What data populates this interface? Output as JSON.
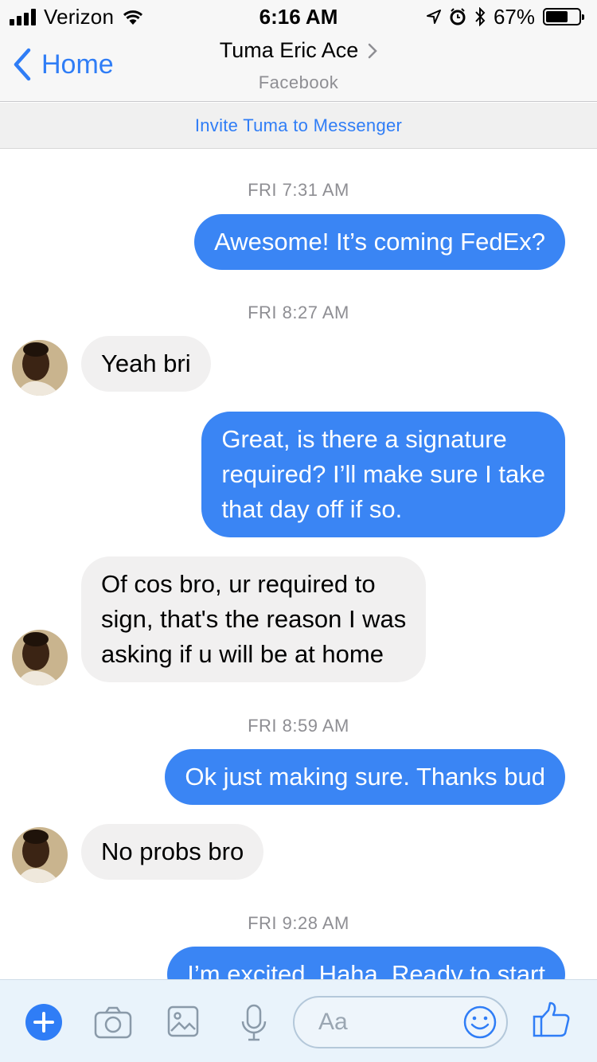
{
  "status_bar": {
    "carrier": "Verizon",
    "time": "6:16 AM",
    "battery_percent": "67%",
    "battery_level": 0.67,
    "icons": [
      "signal-icon",
      "wifi-icon",
      "location-icon",
      "alarm-icon",
      "bluetooth-icon",
      "battery-icon"
    ]
  },
  "nav": {
    "back_label": "Home",
    "title": "Tuma Eric Ace",
    "subtitle": "Facebook"
  },
  "invite_banner": "Invite Tuma to Messenger",
  "conversation": {
    "stamps": [
      "FRI 7:31 AM",
      "FRI 8:27 AM",
      "FRI 8:59 AM",
      "FRI 9:28 AM"
    ],
    "messages": [
      {
        "from": "me",
        "lines": [
          "Awesome! It’s coming FedEx?"
        ]
      },
      {
        "from": "them",
        "lines": [
          "Yeah bri"
        ]
      },
      {
        "from": "me",
        "lines": [
          "Great, is there a signature",
          "required? I’ll make sure I take",
          "that day off if so."
        ]
      },
      {
        "from": "them",
        "lines": [
          "Of cos bro, ur required to",
          "sign, that's the reason I was",
          "asking if u will be at home"
        ]
      },
      {
        "from": "me",
        "lines": [
          "Ok just making sure. Thanks bud"
        ]
      },
      {
        "from": "them",
        "lines": [
          "No probs bro"
        ]
      },
      {
        "from": "me",
        "lines": [
          "I’m excited. Haha. Ready to start"
        ]
      }
    ]
  },
  "composer": {
    "placeholder": "Aa",
    "icons": [
      "plus-icon",
      "camera-icon",
      "gallery-icon",
      "microphone-icon",
      "emoji-icon",
      "thumbs-up-icon"
    ]
  },
  "colors": {
    "accent": "#2f7df6",
    "outgoing_bubble": "#3a85f4",
    "incoming_bubble": "#f1f0f0",
    "composer_bg": "#e9f3fb"
  }
}
